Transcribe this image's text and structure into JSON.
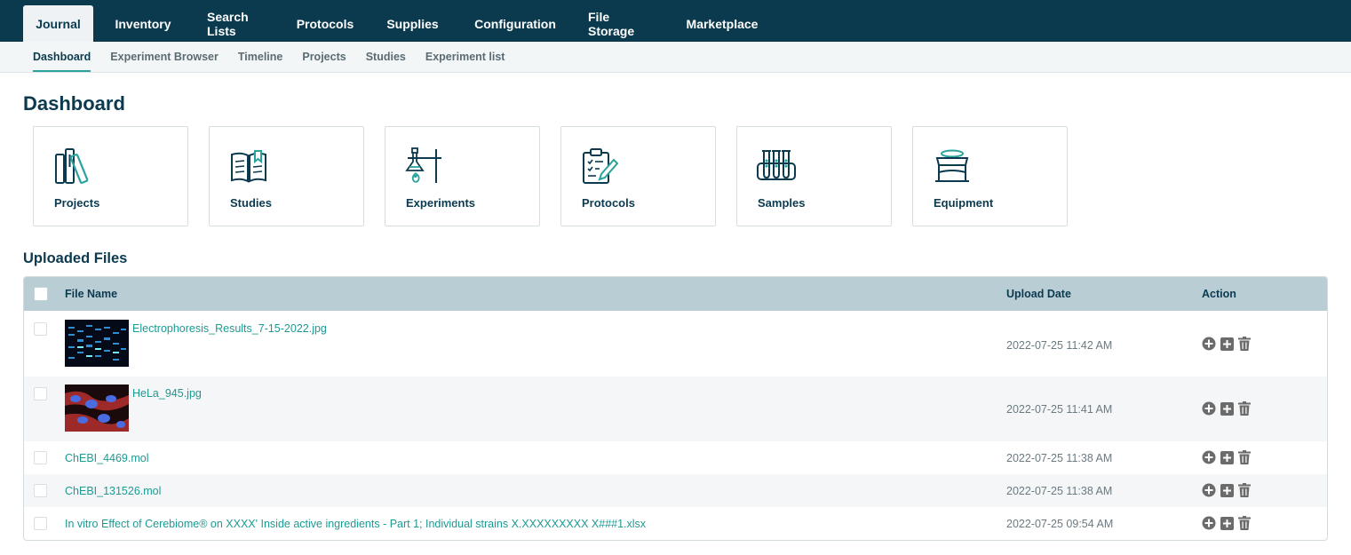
{
  "topnav": {
    "tabs": [
      "Journal",
      "Inventory",
      "Search Lists",
      "Protocols",
      "Supplies",
      "Configuration",
      "File Storage",
      "Marketplace"
    ]
  },
  "subnav": {
    "items": [
      "Dashboard",
      "Experiment Browser",
      "Timeline",
      "Projects",
      "Studies",
      "Experiment list"
    ]
  },
  "page": {
    "title": "Dashboard"
  },
  "cards": [
    {
      "label": "Projects",
      "icon": "projects-icon"
    },
    {
      "label": "Studies",
      "icon": "studies-book-icon"
    },
    {
      "label": "Experiments",
      "icon": "experiments-flask-icon"
    },
    {
      "label": "Protocols",
      "icon": "protocols-clipboard-icon"
    },
    {
      "label": "Samples",
      "icon": "samples-test-tubes-icon"
    },
    {
      "label": "Equipment",
      "icon": "equipment-icon"
    }
  ],
  "uploaded": {
    "title": "Uploaded Files",
    "headers": {
      "file_name": "File Name",
      "upload_date": "Upload Date",
      "action": "Action"
    },
    "rows": [
      {
        "name": "Electrophoresis_Results_7-15-2022.jpg",
        "date": "2022-07-25 11:42 AM",
        "thumb": "electrophoresis-gel"
      },
      {
        "name": "HeLa_945.jpg",
        "date": "2022-07-25 11:41 AM",
        "thumb": "hela-cells"
      },
      {
        "name": "ChEBI_4469.mol",
        "date": "2022-07-25 11:38 AM"
      },
      {
        "name": "ChEBI_131526.mol",
        "date": "2022-07-25 11:38 AM"
      },
      {
        "name": "In vitro Effect of Cerebiome® on XXXX' Inside active ingredients - Part 1; Individual strains X.XXXXXXXXX X###1.xlsx",
        "date": "2022-07-25 09:54 AM"
      }
    ]
  },
  "colors": {
    "nav_bg": "#0b3a4f",
    "accent": "#2aa39c",
    "header_bg": "#b9cdd5",
    "link": "#1d9a92"
  }
}
